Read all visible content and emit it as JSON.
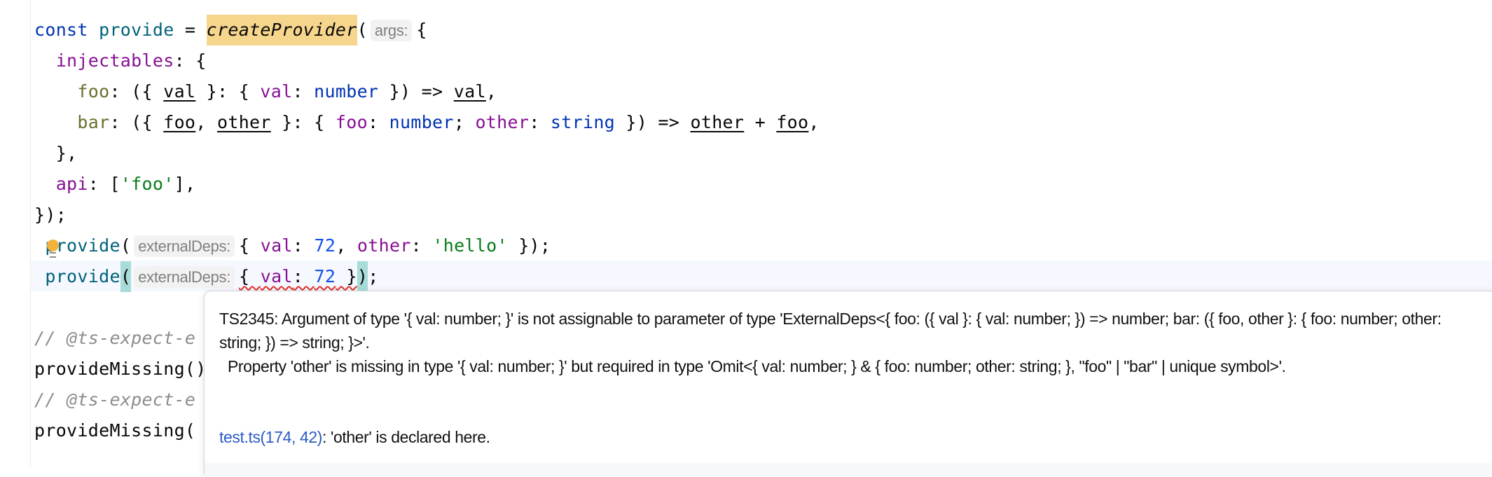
{
  "editor": {
    "lines": [
      [
        {
          "t": "const ",
          "c": "kw"
        },
        {
          "t": "provide",
          "c": "fn"
        },
        {
          "t": " = "
        },
        {
          "t": "createProvider",
          "c": "hl"
        },
        {
          "t": "("
        },
        {
          "t": "args:",
          "c": "hint"
        },
        {
          "t": "{"
        }
      ],
      [
        {
          "t": "  "
        },
        {
          "t": "injectables",
          "c": "prop"
        },
        {
          "t": ": {"
        }
      ],
      [
        {
          "t": "    "
        },
        {
          "t": "foo",
          "c": "key"
        },
        {
          "t": ": ({ "
        },
        {
          "t": "val",
          "c": "u"
        },
        {
          "t": " }: { "
        },
        {
          "t": "val",
          "c": "tprop"
        },
        {
          "t": ": "
        },
        {
          "t": "number",
          "c": "type"
        },
        {
          "t": " }) => "
        },
        {
          "t": "val",
          "c": "u"
        },
        {
          "t": ","
        }
      ],
      [
        {
          "t": "    "
        },
        {
          "t": "bar",
          "c": "key"
        },
        {
          "t": ": ({ "
        },
        {
          "t": "foo",
          "c": "u"
        },
        {
          "t": ", "
        },
        {
          "t": "other",
          "c": "u"
        },
        {
          "t": " }: { "
        },
        {
          "t": "foo",
          "c": "tprop"
        },
        {
          "t": ": "
        },
        {
          "t": "number",
          "c": "type"
        },
        {
          "t": "; "
        },
        {
          "t": "other",
          "c": "tprop"
        },
        {
          "t": ": "
        },
        {
          "t": "string",
          "c": "type"
        },
        {
          "t": " }) => "
        },
        {
          "t": "other",
          "c": "u"
        },
        {
          "t": " + "
        },
        {
          "t": "foo",
          "c": "u"
        },
        {
          "t": ","
        }
      ],
      [
        {
          "t": "  },"
        }
      ],
      [
        {
          "t": "  "
        },
        {
          "t": "api",
          "c": "prop"
        },
        {
          "t": ": ["
        },
        {
          "t": "'foo'",
          "c": "str"
        },
        {
          "t": "],"
        }
      ],
      [
        {
          "t": "});"
        }
      ],
      [
        {
          "t": " "
        },
        {
          "t": "provide",
          "c": "call"
        },
        {
          "t": "("
        },
        {
          "t": "externalDeps:",
          "c": "hint"
        },
        {
          "t": "{ "
        },
        {
          "t": "val",
          "c": "tprop"
        },
        {
          "t": ": "
        },
        {
          "t": "72",
          "c": "num"
        },
        {
          "t": ", "
        },
        {
          "t": "other",
          "c": "tprop"
        },
        {
          "t": ": "
        },
        {
          "t": "'hello'",
          "c": "str"
        },
        {
          "t": " });"
        }
      ],
      [
        {
          "t": " "
        },
        {
          "t": "provide",
          "c": "call"
        },
        {
          "t": "(",
          "c": "match"
        },
        {
          "t": "externalDeps:",
          "c": "hint"
        },
        {
          "t": "{ ",
          "c": "err"
        },
        {
          "t": "val",
          "c": "tprop err"
        },
        {
          "t": ": ",
          "c": "err"
        },
        {
          "t": "72",
          "c": "num err"
        },
        {
          "t": " }",
          "c": "err"
        },
        {
          "t": ")",
          "c": "match"
        },
        {
          "t": ";"
        }
      ],
      [],
      [
        {
          "t": "// @ts-expect-e",
          "c": "cmt"
        }
      ],
      [
        {
          "t": "provideMissing()"
        }
      ],
      [
        {
          "t": "// @ts-expect-e",
          "c": "cmt"
        }
      ],
      [
        {
          "t": "provideMissing("
        }
      ]
    ]
  },
  "tooltip": {
    "message": "TS2345: Argument of type '{ val: number; }' is not assignable to parameter of type 'ExternalDeps<{ foo: ({ val }: { val: number; }) => number; bar: ({ foo, other }: { foo: number; other: string; }) => string; }>'.",
    "detail": "  Property 'other' is missing in type '{ val: number; }' but required in type 'Omit<{ val: number; } & { foo: number; other: string; }, \"foo\" | \"bar\" | unique symbol>'.",
    "link": "test.ts(174, 42)",
    "link_suffix": ": 'other' is declared here."
  },
  "colors": {
    "keyword": "#0033b3",
    "function": "#00627a",
    "property": "#871094",
    "number": "#1750eb",
    "string": "#067d17",
    "comment": "#8c8c8c",
    "usage_highlight": "#f6d58c",
    "brace_match": "#a8dcd8",
    "error_squiggle": "#e0312c",
    "link": "#2a5bc6"
  },
  "icons": {
    "intention": "lightbulb-icon"
  }
}
